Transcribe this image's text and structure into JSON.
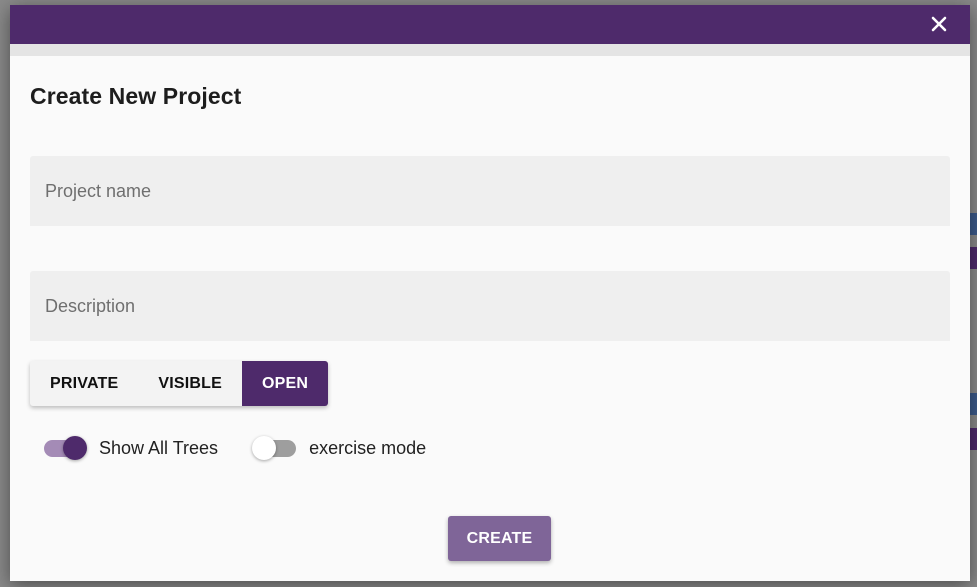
{
  "dialog": {
    "title": "Create New Project",
    "close_icon": "close-icon"
  },
  "form": {
    "project_name": {
      "value": "",
      "placeholder": "Project name"
    },
    "description": {
      "value": "",
      "placeholder": "Description"
    }
  },
  "visibility": {
    "options": [
      "PRIVATE",
      "VISIBLE",
      "OPEN"
    ],
    "selected": "OPEN"
  },
  "toggles": {
    "show_all_trees": {
      "label": "Show All Trees",
      "checked": true
    },
    "exercise_mode": {
      "label": "exercise mode",
      "checked": false
    }
  },
  "actions": {
    "create_label": "CREATE"
  },
  "colors": {
    "accent": "#4e2a6b",
    "accent_light": "#a48bb6",
    "create_button": "#7f6598",
    "field_bg": "#efefef"
  }
}
